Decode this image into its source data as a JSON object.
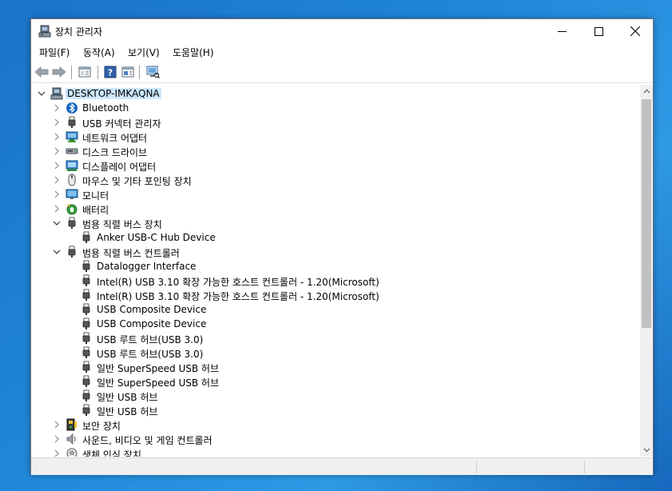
{
  "window": {
    "title": "장치 관리자",
    "controls": [
      "minimize-icon",
      "maximize-icon",
      "close-icon"
    ]
  },
  "menu": [
    "파일(F)",
    "동작(A)",
    "보기(V)",
    "도움말(H)"
  ],
  "toolbar": [
    "back-arrow-icon",
    "forward-arrow-icon",
    "properties-icon",
    "help-icon",
    "view-icon",
    "scan-hardware-icon"
  ],
  "tree": {
    "root": "DESKTOP-IMKAQNA",
    "items": [
      {
        "label": "Bluetooth",
        "level": 1,
        "state": "collapsed",
        "icon": "bluetooth-icon"
      },
      {
        "label": "USB 커넥터 관리자",
        "level": 1,
        "state": "collapsed",
        "icon": "usb-plug-icon"
      },
      {
        "label": "네트워크 어댑터",
        "level": 1,
        "state": "collapsed",
        "icon": "network-adapter-icon"
      },
      {
        "label": "디스크 드라이브",
        "level": 1,
        "state": "collapsed",
        "icon": "disk-drive-icon"
      },
      {
        "label": "디스플레이 어댑터",
        "level": 1,
        "state": "collapsed",
        "icon": "display-adapter-icon"
      },
      {
        "label": "마우스 및 기타 포인팅 장치",
        "level": 1,
        "state": "collapsed",
        "icon": "mouse-icon"
      },
      {
        "label": "모니터",
        "level": 1,
        "state": "collapsed",
        "icon": "monitor-icon"
      },
      {
        "label": "배터리",
        "level": 1,
        "state": "collapsed",
        "icon": "battery-icon"
      },
      {
        "label": "범용 직렬 버스 장치",
        "level": 1,
        "state": "expanded",
        "icon": "usb-plug-icon"
      },
      {
        "label": "Anker USB-C Hub Device",
        "level": 2,
        "state": "leaf",
        "icon": "usb-plug-icon"
      },
      {
        "label": "범용 직렬 버스 컨트롤러",
        "level": 1,
        "state": "expanded",
        "icon": "usb-plug-icon"
      },
      {
        "label": "Datalogger Interface",
        "level": 2,
        "state": "leaf",
        "icon": "usb-plug-icon"
      },
      {
        "label": "Intel(R) USB 3.10 확장 가능한 호스트 컨트롤러 - 1.20(Microsoft)",
        "level": 2,
        "state": "leaf",
        "icon": "usb-plug-icon"
      },
      {
        "label": "Intel(R) USB 3.10 확장 가능한 호스트 컨트롤러 - 1.20(Microsoft)",
        "level": 2,
        "state": "leaf",
        "icon": "usb-plug-icon"
      },
      {
        "label": "USB Composite Device",
        "level": 2,
        "state": "leaf",
        "icon": "usb-plug-icon"
      },
      {
        "label": "USB Composite Device",
        "level": 2,
        "state": "leaf",
        "icon": "usb-plug-icon"
      },
      {
        "label": "USB 루트 허브(USB 3.0)",
        "level": 2,
        "state": "leaf",
        "icon": "usb-plug-icon"
      },
      {
        "label": "USB 루트 허브(USB 3.0)",
        "level": 2,
        "state": "leaf",
        "icon": "usb-plug-icon"
      },
      {
        "label": "일반 SuperSpeed USB 허브",
        "level": 2,
        "state": "leaf",
        "icon": "usb-plug-icon"
      },
      {
        "label": "일반 SuperSpeed USB 허브",
        "level": 2,
        "state": "leaf",
        "icon": "usb-plug-icon"
      },
      {
        "label": "일반 USB 허브",
        "level": 2,
        "state": "leaf",
        "icon": "usb-plug-icon"
      },
      {
        "label": "일반 USB 허브",
        "level": 2,
        "state": "leaf",
        "icon": "usb-plug-icon"
      },
      {
        "label": "보안 장치",
        "level": 1,
        "state": "collapsed",
        "icon": "security-device-icon"
      },
      {
        "label": "사운드, 비디오 및 게임 컨트롤러",
        "level": 1,
        "state": "collapsed",
        "icon": "speaker-icon"
      },
      {
        "label": "생체 인식 장치",
        "level": 1,
        "state": "collapsed",
        "icon": "biometric-icon"
      }
    ]
  },
  "colors": {
    "selection": "#cce8ff",
    "desktop": "#1f86d8",
    "scroll_thumb": "#c1c1c1"
  }
}
